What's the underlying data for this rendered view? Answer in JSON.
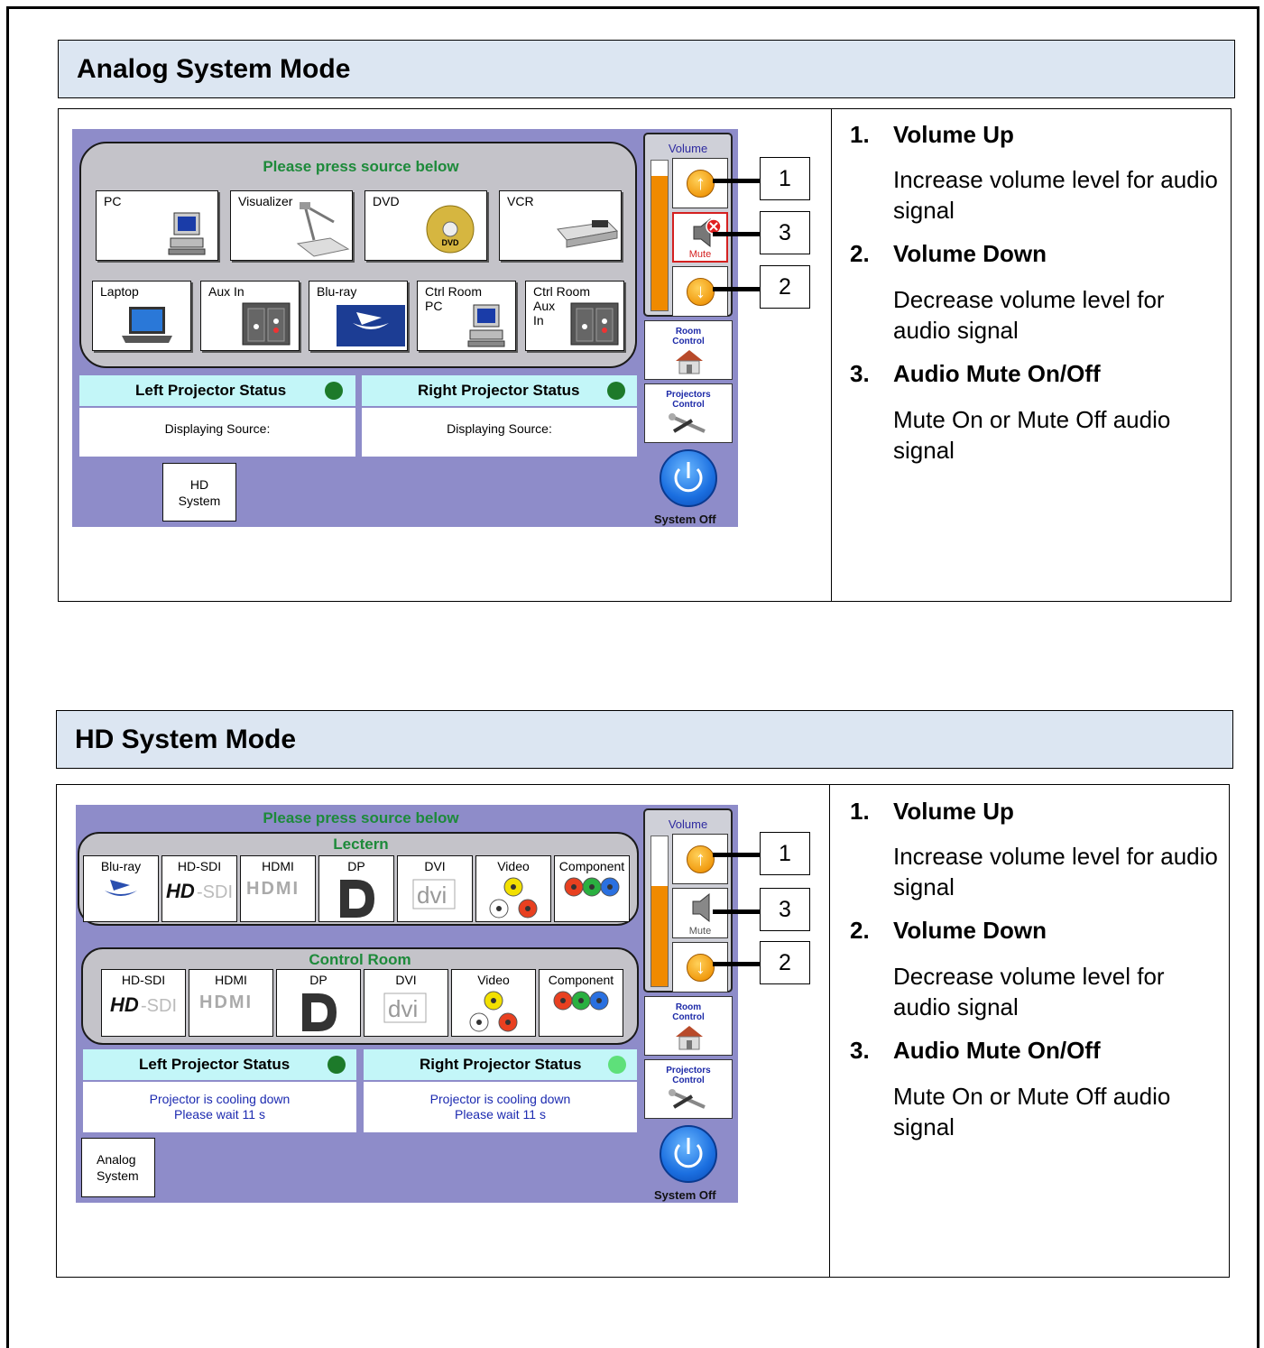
{
  "analog": {
    "title": "Analog System Mode",
    "prompt": "Please press source below",
    "sources_top": [
      "PC",
      "Visualizer",
      "DVD",
      "VCR"
    ],
    "sources_bottom": [
      "Laptop",
      "Aux In",
      "Blu-ray",
      "Ctrl Room\nPC",
      "Ctrl Room\nAux\nIn"
    ],
    "left_status": "Left Projector Status",
    "right_status": "Right Projector Status",
    "left_body": "Displaying Source:",
    "right_body": "Displaying Source:",
    "mode_button": "HD\nSystem",
    "volume_level": 0.9,
    "mute_active": true
  },
  "hd": {
    "title": "HD System Mode",
    "prompt": "Please press source below",
    "lectern_label": "Lectern",
    "control_room_label": "Control Room",
    "lectern_sources": [
      "Blu-ray",
      "HD-SDI",
      "HDMI",
      "DP",
      "DVI",
      "Video",
      "Component"
    ],
    "control_sources": [
      "HD-SDI",
      "HDMI",
      "DP",
      "DVI",
      "Video",
      "Component"
    ],
    "left_status": "Left Projector Status",
    "right_status": "Right Projector Status",
    "left_body": "Projector is cooling down\nPlease wait   11   s",
    "right_body": "Projector is cooling down\nPlease wait   11   s",
    "mode_button": "Analog\nSystem",
    "volume_level": 0.67,
    "mute_active": false
  },
  "controls": {
    "volume_title": "Volume",
    "mute_label": "Mute",
    "room_control": "Room\nControl",
    "projectors_control": "Projectors\nControl",
    "system_off": "System Off"
  },
  "callouts": [
    "1",
    "3",
    "2"
  ],
  "notes": [
    {
      "num": "1.",
      "title": "Volume Up",
      "desc": "Increase volume level for audio signal"
    },
    {
      "num": "2.",
      "title": "Volume Down",
      "desc": "Decrease volume level for audio signal"
    },
    {
      "num": "3.",
      "title": "Audio Mute On/Off",
      "desc": "Mute On or Mute Off audio signal"
    }
  ],
  "colors": {
    "panel_bg": "#8e8cc9",
    "section_header_bg": "#dce6f2",
    "prompt_green": "#1d8a3a",
    "status_cyan": "#c3f6f8",
    "volume_orange": "#f08a00",
    "status_dark_green": "#1d7a2a",
    "status_light_green": "#5ee07a"
  }
}
